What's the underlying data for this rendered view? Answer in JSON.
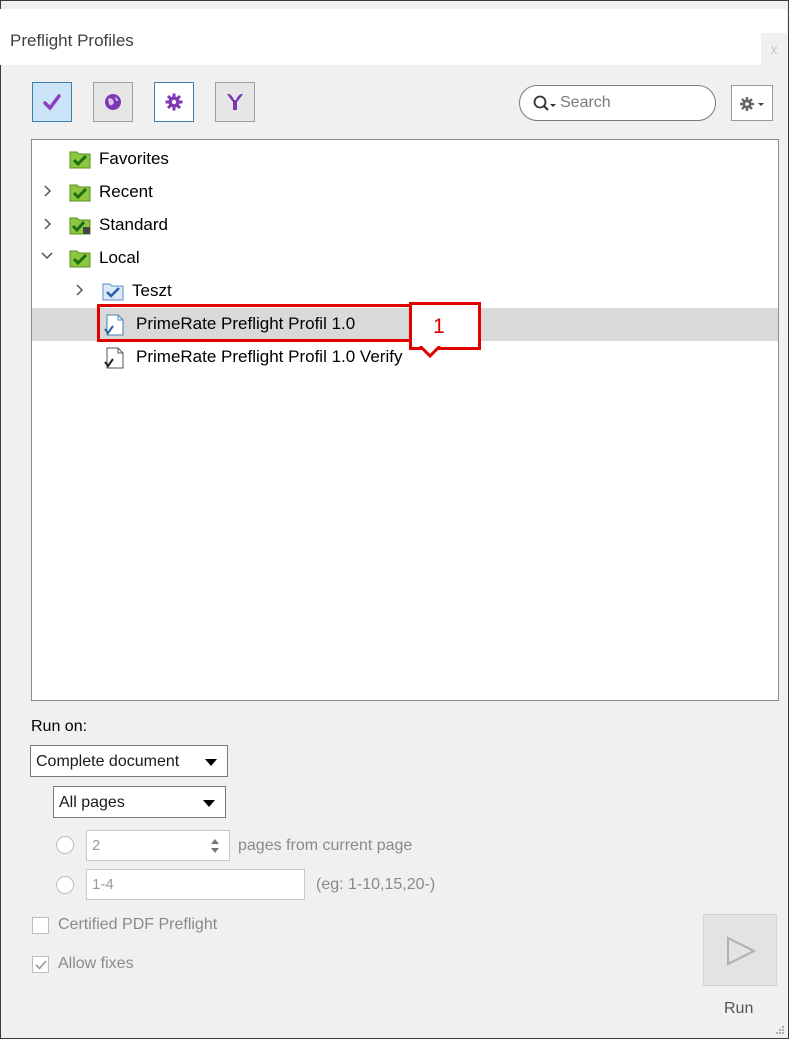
{
  "window": {
    "title": "Preflight Profiles",
    "close_glyph": "x"
  },
  "toolbar": {
    "buttons": [
      {
        "name": "checkmark-icon",
        "active": true
      },
      {
        "name": "globe-icon",
        "active": false
      },
      {
        "name": "gear-icon",
        "active": false
      },
      {
        "name": "wrench-icon",
        "active": false
      }
    ],
    "search": {
      "placeholder": "Search"
    },
    "options_menu": {
      "icon": "gear-icon"
    }
  },
  "tree": {
    "items": [
      {
        "label": "Favorites",
        "level": 0,
        "expander": "none",
        "icon": "checked-folder-icon"
      },
      {
        "label": "Recent",
        "level": 0,
        "expander": "collapsed",
        "icon": "checked-folder-icon"
      },
      {
        "label": "Standard",
        "level": 0,
        "expander": "collapsed",
        "icon": "locked-checked-folder-icon"
      },
      {
        "label": "Local",
        "level": 0,
        "expander": "expanded",
        "icon": "checked-folder-icon"
      },
      {
        "label": "Teszt",
        "level": 1,
        "expander": "collapsed",
        "icon": "blue-checked-folder-icon"
      },
      {
        "label": "PrimeRate Preflight Profil 1.0",
        "level": 2,
        "expander": "none",
        "icon": "profile-document-icon",
        "selected": true
      },
      {
        "label": "PrimeRate Preflight Profil 1.0 Verify",
        "level": 2,
        "expander": "none",
        "icon": "verify-profile-icon"
      }
    ]
  },
  "annotation": {
    "number": "1",
    "color": "#e00000"
  },
  "run_on": {
    "label": "Run on:",
    "scope_dropdown": "Complete document",
    "pages_dropdown": "All pages",
    "pages_from_current": {
      "value": "2",
      "suffix": "pages from current page"
    },
    "range": {
      "value": "1-4",
      "hint": "(eg: 1-10,15,20-)"
    }
  },
  "options": {
    "certified": {
      "label": "Certified PDF Preflight",
      "checked": false
    },
    "allow_fixes": {
      "label": "Allow fixes",
      "checked": true
    }
  },
  "run_button": {
    "label": "Run"
  },
  "colors": {
    "accent": "#3c7fb1",
    "folder_green": "#7fba00",
    "selection": "#d9d9d9"
  }
}
